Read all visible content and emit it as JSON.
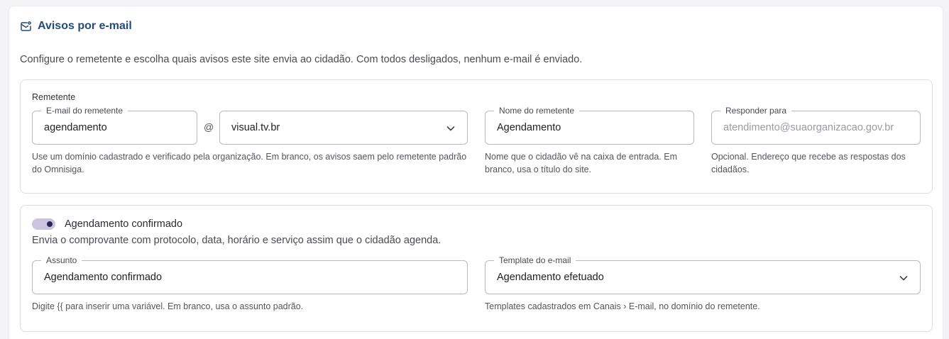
{
  "header": {
    "title": "Avisos por e-mail",
    "description": "Configure o remetente e escolha quais avisos este site envia ao cidadão. Com todos desligados, nenhum e-mail é enviado."
  },
  "sender": {
    "group_label": "Remetente",
    "email_label": "E-mail do remetente",
    "email_value": "agendamento",
    "at_symbol": "@",
    "domain_value": "visual.tv.br",
    "email_help": "Use um domínio cadastrado e verificado pela organização. Em branco, os avisos saem pelo remetente padrão do Omnisiga.",
    "name_label": "Nome do remetente",
    "name_value": "Agendamento",
    "name_help": "Nome que o cidadão vê na caixa de entrada. Em branco, usa o título do site.",
    "reply_label": "Responder para",
    "reply_placeholder": "atendimento@suaorganizacao.gov.br",
    "reply_help": "Opcional. Endereço que recebe as respostas dos cidadãos."
  },
  "notice_confirmed": {
    "toggle_on": true,
    "title": "Agendamento confirmado",
    "description": "Envia o comprovante com protocolo, data, horário e serviço assim que o cidadão agenda.",
    "subject_label": "Assunto",
    "subject_value": "Agendamento confirmado",
    "subject_help": "Digite {{ para inserir uma variável. Em branco, usa o assunto padrão.",
    "template_label": "Template do e-mail",
    "template_value": "Agendamento efetuado",
    "template_help": "Templates cadastrados em Canais › E-mail, no domínio do remetente."
  },
  "colors": {
    "title": "#244c77",
    "toggle_track": "#cbc4de",
    "toggle_knob": "#2b2455"
  }
}
